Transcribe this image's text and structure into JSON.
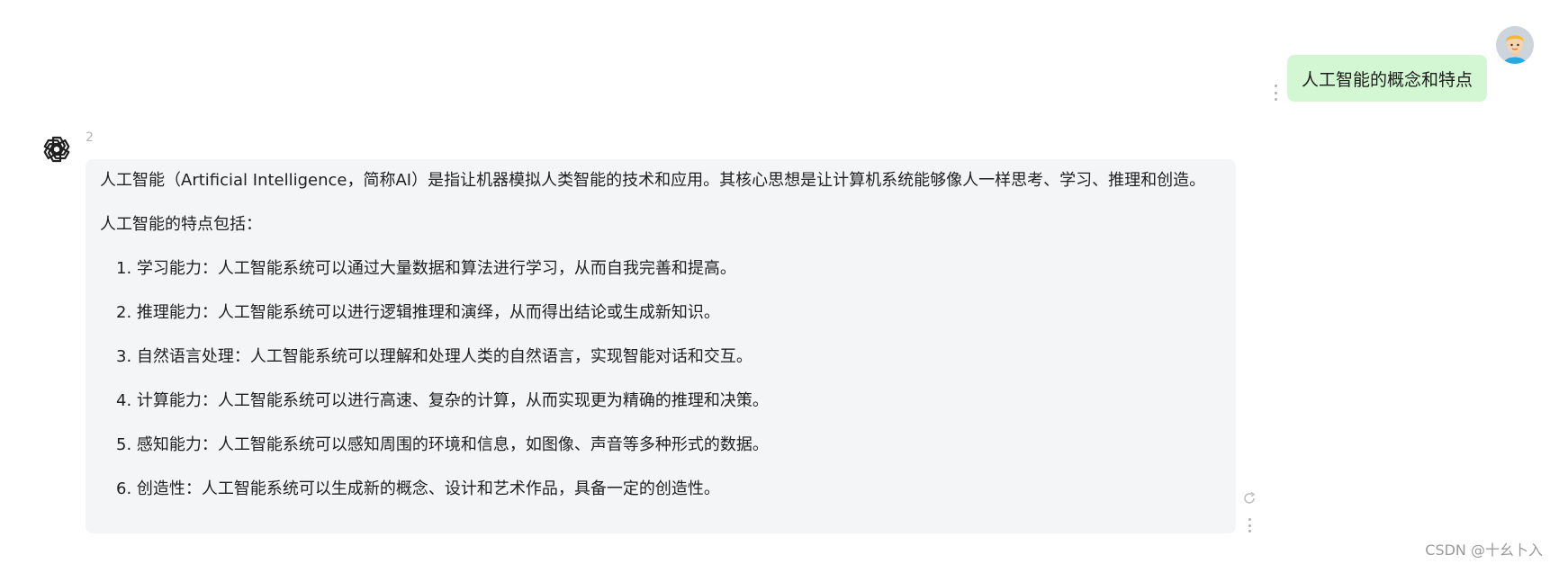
{
  "user_message": {
    "text": "人工智能的概念和特点"
  },
  "assistant_message": {
    "index": "2",
    "intro": "人工智能（Artificial Intelligence，简称AI）是指让机器模拟人类智能的技术和应用。其核心思想是让计算机系统能够像人一样思考、学习、推理和创造。",
    "subheading": "人工智能的特点包括：",
    "features": [
      "1. 学习能力：人工智能系统可以通过大量数据和算法进行学习，从而自我完善和提高。",
      "2. 推理能力：人工智能系统可以进行逻辑推理和演绎，从而得出结论或生成新知识。",
      "3. 自然语言处理：人工智能系统可以理解和处理人类的自然语言，实现智能对话和交互。",
      "4. 计算能力：人工智能系统可以进行高速、复杂的计算，从而实现更为精确的推理和决策。",
      "5. 感知能力：人工智能系统可以感知周围的环境和信息，如图像、声音等多种形式的数据。",
      "6. 创造性：人工智能系统可以生成新的概念、设计和艺术作品，具备一定的创造性。"
    ]
  },
  "watermark": "CSDN @十幺卜入",
  "icons": {
    "user_avatar": "user-avatar-icon",
    "bot_avatar": "openai-logo-icon",
    "more": "more-vertical-icon",
    "refresh": "refresh-icon"
  },
  "colors": {
    "user_bubble": "#d2f7d2",
    "assistant_bubble": "#f4f5f7"
  }
}
